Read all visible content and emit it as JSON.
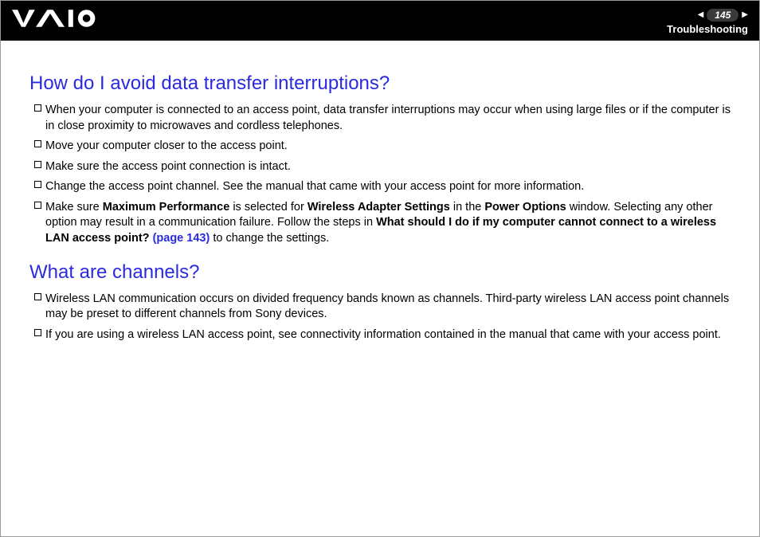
{
  "header": {
    "page_number": "145",
    "section": "Troubleshooting"
  },
  "sections": [
    {
      "heading": "How do I avoid data transfer interruptions?",
      "items": [
        {
          "parts": [
            {
              "t": "When your computer is connected to an access point, data transfer interruptions may occur when using large files or if the computer is in close proximity to microwaves and cordless telephones."
            }
          ]
        },
        {
          "parts": [
            {
              "t": "Move your computer closer to the access point."
            }
          ]
        },
        {
          "parts": [
            {
              "t": "Make sure the access point connection is intact."
            }
          ]
        },
        {
          "parts": [
            {
              "t": "Change the access point channel. See the manual that came with your access point for more information."
            }
          ]
        },
        {
          "parts": [
            {
              "t": "Make sure "
            },
            {
              "t": "Maximum Performance",
              "b": true
            },
            {
              "t": " is selected for "
            },
            {
              "t": "Wireless Adapter Settings",
              "b": true
            },
            {
              "t": " in the "
            },
            {
              "t": "Power Options",
              "b": true
            },
            {
              "t": " window. Selecting any other option may result in a communication failure. Follow the steps in "
            },
            {
              "t": "What should I do if my computer cannot connect to a wireless LAN access point? ",
              "b": true
            },
            {
              "t": "(page 143)",
              "link": true
            },
            {
              "t": " to change the settings."
            }
          ]
        }
      ]
    },
    {
      "heading": "What are channels?",
      "items": [
        {
          "parts": [
            {
              "t": "Wireless LAN communication occurs on divided frequency bands known as channels. Third-party wireless LAN access point channels may be preset to different channels from Sony devices."
            }
          ]
        },
        {
          "parts": [
            {
              "t": "If you are using a wireless LAN access point, see connectivity information contained in the manual that came with your access point."
            }
          ]
        }
      ]
    }
  ]
}
